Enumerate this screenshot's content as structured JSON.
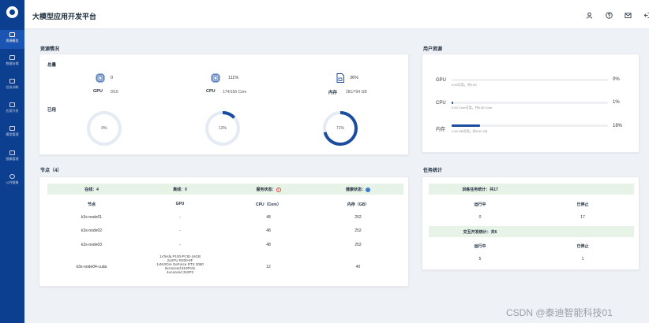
{
  "app": {
    "title": "大模型应用开发平台"
  },
  "sidebar": {
    "items": [
      {
        "label": "资源概览"
      },
      {
        "label": "数据存储"
      },
      {
        "label": "任务训练"
      },
      {
        "label": "应用开发"
      },
      {
        "label": "模型管理"
      },
      {
        "label": "镜像管理"
      },
      {
        "label": "公共镜像"
      }
    ]
  },
  "header": {
    "icons": [
      "user-icon",
      "help-icon",
      "message-icon",
      "logout-icon"
    ]
  },
  "resources": {
    "title": "资源情况",
    "total_title": "总量",
    "usage_title": "已用",
    "gpu": {
      "label": "GPU",
      "count": "0",
      "detail": "0/16"
    },
    "cpu": {
      "label": "CPU",
      "count": "111%",
      "detail": "174/156 Core"
    },
    "mem": {
      "label": "内存",
      "count": "36%",
      "detail": "281/794 GB"
    },
    "usage": [
      {
        "text": "0%",
        "value": 0
      },
      {
        "text": "13%",
        "value": 13
      },
      {
        "text": "71%",
        "value": 71
      }
    ]
  },
  "user_resources": {
    "title": "用户资源",
    "rows": [
      {
        "label": "GPU",
        "sub": "0.00可用，共0.00",
        "pct_text": "0%",
        "value": 0
      },
      {
        "label": "CPU",
        "sub": "6.00 Core可用，共6.00 Core",
        "pct_text": "1%",
        "value": 1
      },
      {
        "label": "内存",
        "sub": "1.63 GB可用，共9.00 GB",
        "pct_text": "18%",
        "value": 18
      }
    ]
  },
  "nodes": {
    "title": "节点（4）",
    "summary": {
      "online": "在线：4",
      "offline": "离线：0",
      "service_status": "服务状态：",
      "health_status": "健康状态："
    },
    "columns": [
      "节点",
      "GPU",
      "CPU（Core）",
      "内存（GB）"
    ],
    "rows": [
      {
        "node": "k3s-node01",
        "gpu": "-",
        "cpu": "48",
        "mem": "252"
      },
      {
        "node": "k3s-node02",
        "gpu": "-",
        "cpu": "48",
        "mem": "252"
      },
      {
        "node": "k3s-node03",
        "gpu": "-",
        "cpu": "48",
        "mem": "252"
      },
      {
        "node": "k3s-node04-cuda",
        "gpu_lines": [
          "1xTesla P100-PCIE-16GB",
          "2xXPU R200-8F",
          "1xNVIDIA GeForce RTX 3090",
          "8xAscend 910Prob",
          "4xAscend 310P3"
        ],
        "cpu": "12",
        "mem": "40"
      }
    ]
  },
  "tasks": {
    "title": "任务统计",
    "training": {
      "title": "训练任务统计：共17",
      "cols": [
        "运行中",
        "已停止"
      ],
      "values": [
        "0",
        "17"
      ]
    },
    "interactive": {
      "title": "交互开发统计：共6",
      "cols": [
        "运行中",
        "已停止"
      ],
      "values": [
        "5",
        "1"
      ]
    }
  },
  "colors": {
    "sidebar": "#0c3f8f",
    "accent": "#1a4da0",
    "table_head": "#e8f3e8"
  },
  "watermark": "CSDN @泰迪智能科技01"
}
